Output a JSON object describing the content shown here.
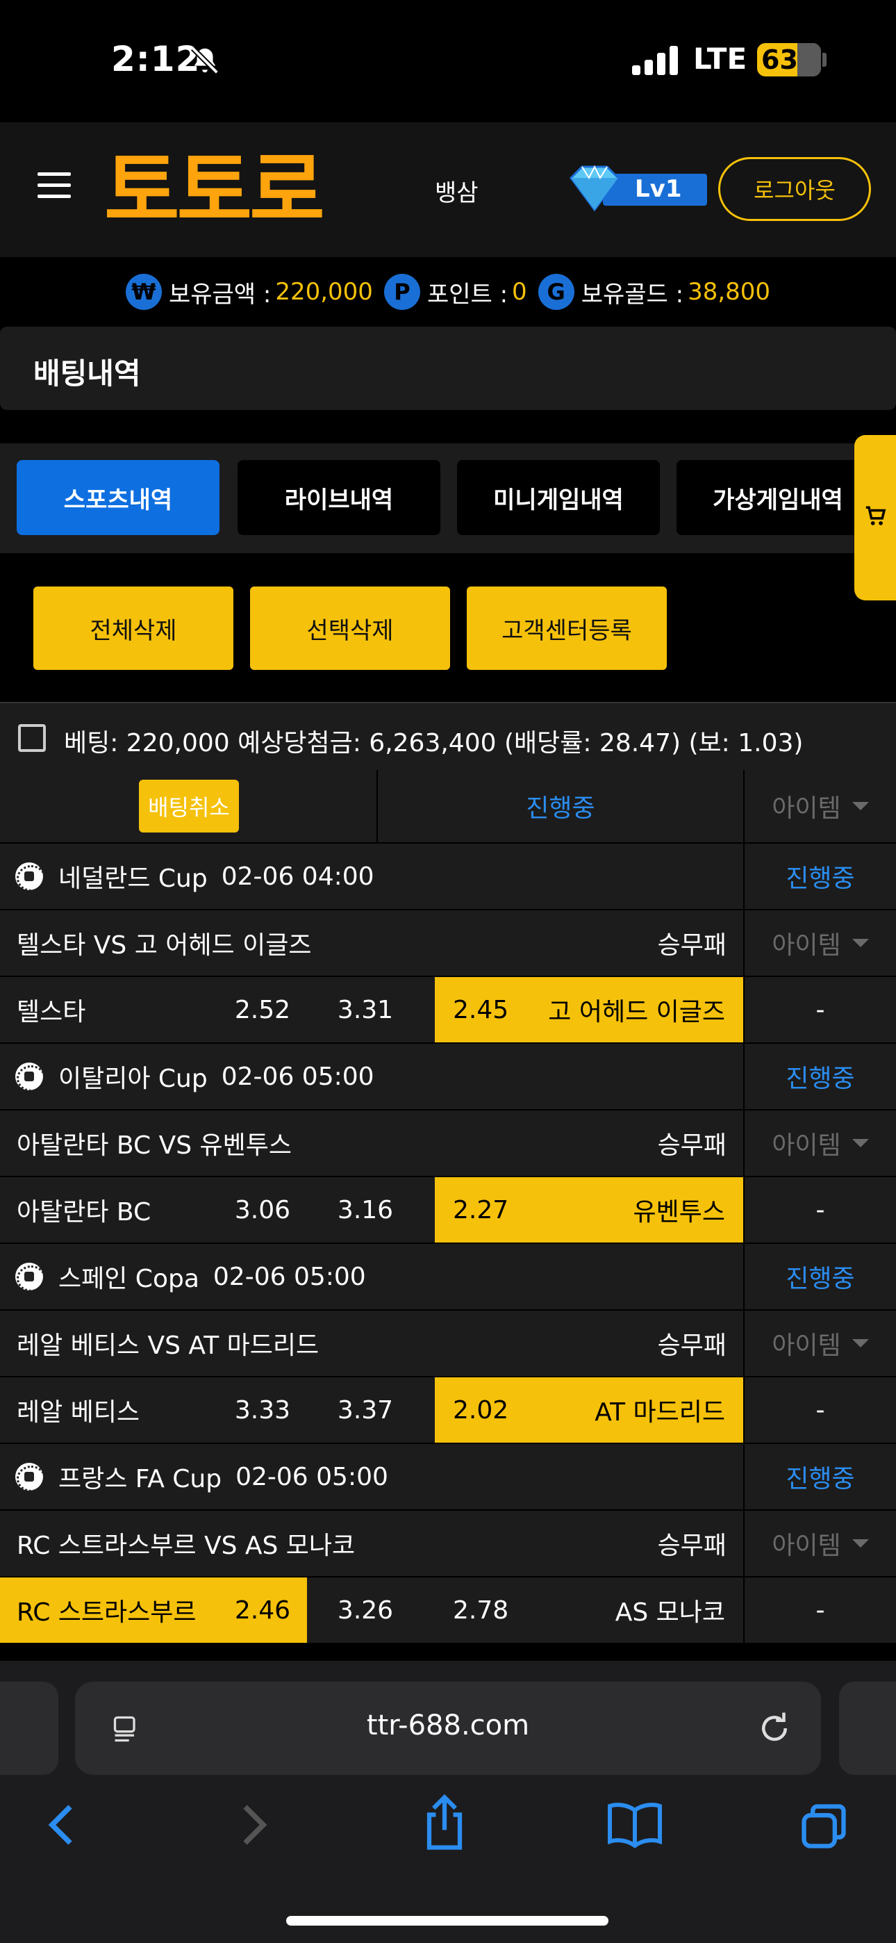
{
  "status_bar": {
    "time": "2:12",
    "network": "LTE",
    "battery": "63"
  },
  "header": {
    "logo": "토토로",
    "link": "뱅삼",
    "level": "Lv1",
    "logout": "로그아웃"
  },
  "balance": {
    "won_icon": "₩",
    "won_label": "보유금액 :",
    "won_value": "220,000",
    "point_icon": "P",
    "point_label": "포인트 :",
    "point_value": "0",
    "gold_icon": "G",
    "gold_label": "보유골드 :",
    "gold_value": "38,800"
  },
  "page_title": "배팅내역",
  "tabs": [
    "스포츠내역",
    "라이브내역",
    "미니게임내역",
    "가상게임내역"
  ],
  "actions": [
    "전체삭제",
    "선택삭제",
    "고객센터등록"
  ],
  "summary": "베팅: 220,000 예상당첨금: 6,263,400 (배당률: 28.47) (보: 1.03)",
  "bet_header": {
    "cancel": "배팅취소",
    "status": "진행중",
    "item": "아이템"
  },
  "matches": [
    {
      "league": "네덜란드 Cup",
      "time": "02-06 04:00",
      "status": "진행중",
      "teams": "텔스타 VS 고 어헤드 이글즈",
      "market": "승무패",
      "item": "아이템",
      "home": "텔스타",
      "home_odds": "2.52",
      "draw_odds": "3.31",
      "away_odds": "2.45",
      "away": "고 어헤드 이글즈",
      "result": "-"
    },
    {
      "league": "이탈리아 Cup",
      "time": "02-06 05:00",
      "status": "진행중",
      "teams": "아탈란타 BC VS 유벤투스",
      "market": "승무패",
      "item": "아이템",
      "home": "아탈란타 BC",
      "home_odds": "3.06",
      "draw_odds": "3.16",
      "away_odds": "2.27",
      "away": "유벤투스",
      "result": "-"
    },
    {
      "league": "스페인 Copa",
      "time": "02-06 05:00",
      "status": "진행중",
      "teams": "레알 베티스 VS AT 마드리드",
      "market": "승무패",
      "item": "아이템",
      "home": "레알 베티스",
      "home_odds": "3.33",
      "draw_odds": "3.37",
      "away_odds": "2.02",
      "away": "AT 마드리드",
      "result": "-"
    },
    {
      "league": "프랑스 FA Cup",
      "time": "02-06 05:00",
      "status": "진행중",
      "teams": "RC 스트라스부르 VS AS 모나코",
      "market": "승무패",
      "item": "아이템",
      "home": "RC 스트라스부르",
      "home_odds": "2.46",
      "draw_odds": "3.26",
      "away_odds": "2.78",
      "away": "AS 모나코",
      "result": "-"
    }
  ],
  "browser": {
    "url": "ttr-688.com"
  },
  "colors": {
    "accent_yellow": "#f6c10a",
    "logo_orange": "#ffa40c",
    "active_blue": "#0e6fe0",
    "status_blue": "#2b8df0"
  }
}
